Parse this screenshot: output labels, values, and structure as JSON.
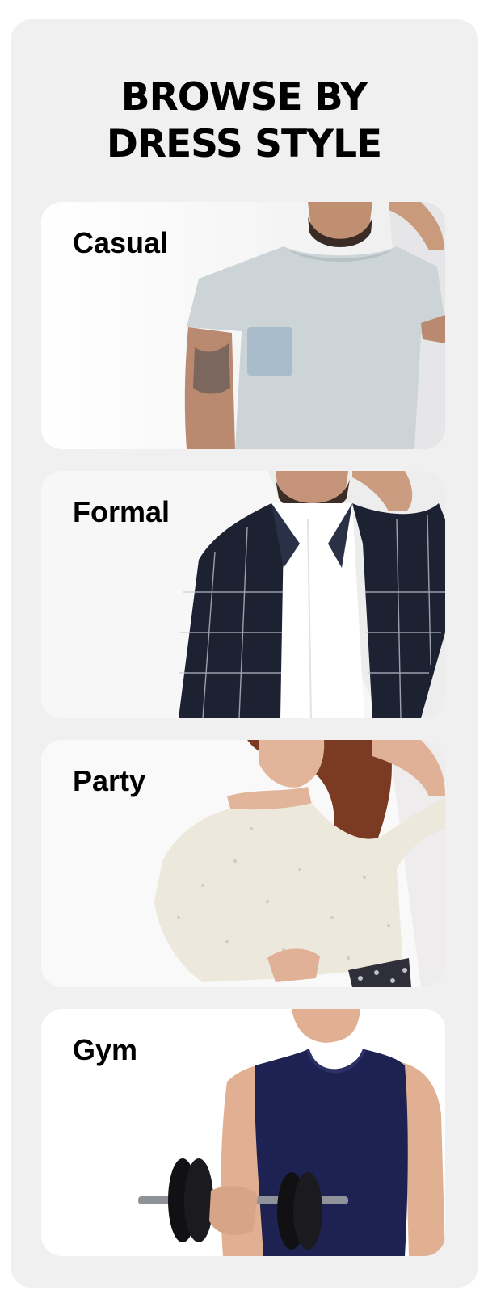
{
  "section": {
    "heading_line1": "BROWSE BY",
    "heading_line2": "DRESS STYLE"
  },
  "styles": [
    {
      "label": "Casual",
      "image": "man-in-grey-tshirt"
    },
    {
      "label": "Formal",
      "image": "man-in-checked-blazer"
    },
    {
      "label": "Party",
      "image": "woman-in-knit-sweater"
    },
    {
      "label": "Gym",
      "image": "man-in-tank-top-with-dumbbell"
    }
  ],
  "colors": {
    "panel_bg": "#f0f0f0",
    "card_bg": "#ffffff",
    "text": "#000000"
  }
}
